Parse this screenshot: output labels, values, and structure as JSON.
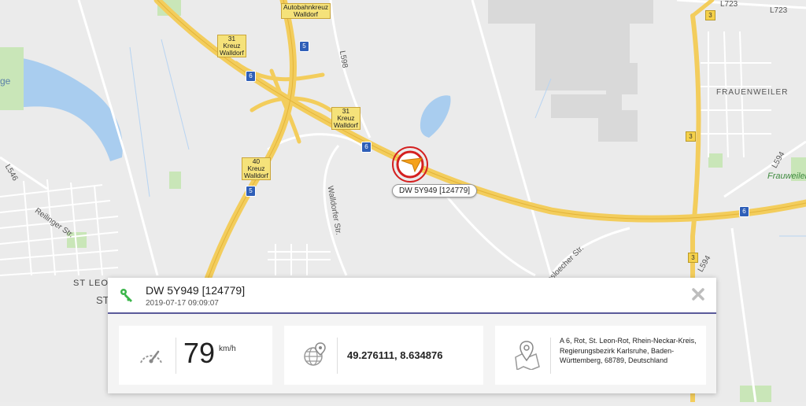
{
  "map": {
    "labels": {
      "autobahnkreuz": "Autobahnkreuz\nWalldorf",
      "kreuz31_top": "31\nKreuz\nWalldorf",
      "kreuz31_mid": "31\nKreuz\nWalldorf",
      "kreuz40": "40\nKreuz\nWalldorf",
      "l598": "L598",
      "l723_a": "L723",
      "l723_b": "L723",
      "frauenweiler": "FRAUENWEILER",
      "frauweiler2": "Frauweiler",
      "l546": "L546",
      "l594_a": "L594",
      "l594_b": "L594",
      "st_leon": "ST LEON",
      "reilinger": "Reilinger Str.",
      "walldorfer": "Walldorfer Str.",
      "esloecher": "esloecher Str.",
      "ge": "ge",
      "st": "ST"
    },
    "shields": {
      "a5_top": "5",
      "a5_mid": "5",
      "a6_a": "6",
      "a6_b": "6",
      "a6_c": "6",
      "b3_a": "3",
      "b3_b": "3",
      "b3_c": "3"
    },
    "vehicle_label": "DW 5Y949 [124779]"
  },
  "panel": {
    "title": "DW 5Y949 [124779]",
    "timestamp": "2019-07-17 09:09:07",
    "speed": {
      "value": "79",
      "unit": "km/h"
    },
    "coordinates": "49.276111, 8.634876",
    "address": "A 6, Rot, St. Leon-Rot, Rhein-Neckar-Kreis, Regierungsbezirk Karlsruhe, Baden-Württemberg, 68789, Deutschland"
  },
  "colors": {
    "accent": "#5a5a9a",
    "marker_red": "#d42020",
    "vehicle_orange": "#f5a21b",
    "key_green": "#3bb54a"
  }
}
